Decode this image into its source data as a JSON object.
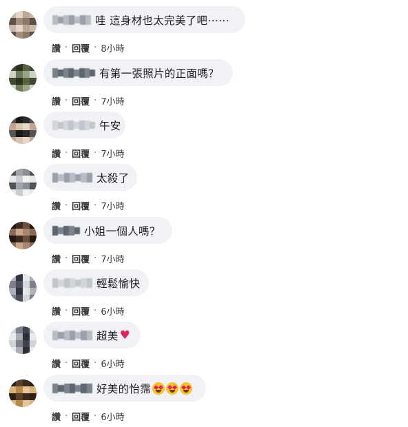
{
  "comments": [
    {
      "text": "哇 這身材也太完美了吧⋯⋯",
      "like": "讚",
      "reply": "回覆",
      "time": "8小時"
    },
    {
      "text": "有第一張照片的正面嗎？",
      "like": "讚",
      "reply": "回覆",
      "time": "7小時"
    },
    {
      "text": "午安",
      "like": "讚",
      "reply": "回覆",
      "time": "7小時"
    },
    {
      "text": "太殺了",
      "like": "讚",
      "reply": "回覆",
      "time": "7小時"
    },
    {
      "text": "小姐一個人嗎？",
      "like": "讚",
      "reply": "回覆",
      "time": "7小時"
    },
    {
      "text": "輕鬆愉快",
      "like": "讚",
      "reply": "回覆",
      "time": "6小時"
    },
    {
      "text": "超美",
      "like": "讚",
      "reply": "回覆",
      "time": "6小時",
      "suffix_icon": "red-heart-icon"
    },
    {
      "text": "好美的怡霈",
      "like": "讚",
      "reply": "回覆",
      "time": "6小時",
      "suffix_icon": "heart-eyes-emoji-icon"
    }
  ],
  "colors": {
    "bubble": "#f0f2f5",
    "text": "#1c1e21",
    "heart": "#e0245e"
  }
}
